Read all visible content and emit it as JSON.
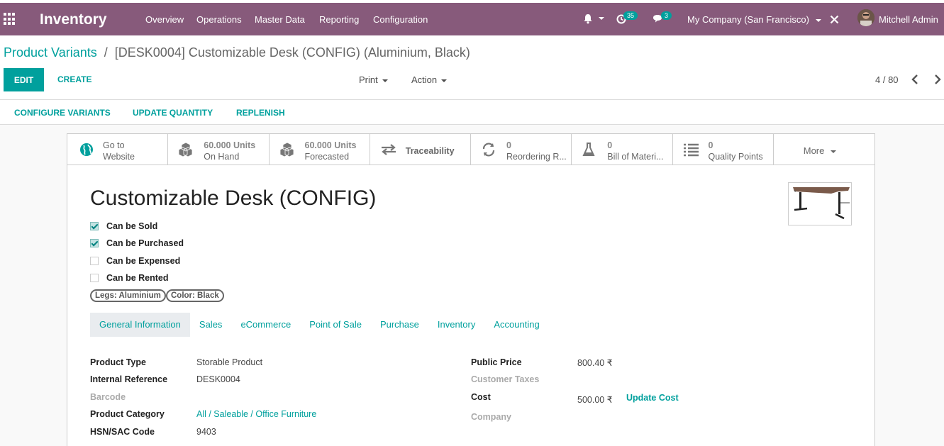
{
  "navbar": {
    "app_title": "Inventory",
    "menus": [
      "Overview",
      "Operations",
      "Master Data",
      "Reporting",
      "Configuration"
    ],
    "activity_count": "35",
    "message_count": "3",
    "company": "My Company (San Francisco)",
    "user": "Mitchell Admin",
    "colors": {
      "bar": "#875a7b",
      "badge": "#00a09d"
    }
  },
  "breadcrumb": {
    "parent": "Product Variants",
    "separator": "/",
    "current": "[DESK0004] Customizable Desk (CONFIG) (Aluminium, Black)"
  },
  "control_panel": {
    "edit": "EDIT",
    "create": "CREATE",
    "print": "Print",
    "action": "Action",
    "pager": "4 / 80"
  },
  "action_bar": [
    "CONFIGURE VARIANTS",
    "UPDATE QUANTITY",
    "REPLENISH"
  ],
  "smart_buttons": [
    {
      "icon": "globe-icon",
      "line1": "Go to",
      "line2": "Website"
    },
    {
      "icon": "cubes-icon",
      "line1": "60.000 Units",
      "line2": "On Hand"
    },
    {
      "icon": "cubes-icon",
      "line1": "60.000 Units",
      "line2": "Forecasted"
    },
    {
      "icon": "exchange-arrows-icon",
      "line1": "Traceability",
      "line2": ""
    },
    {
      "icon": "refresh-icon",
      "line1": "0",
      "line2": "Reordering R..."
    },
    {
      "icon": "flask-icon",
      "line1": "0",
      "line2": "Bill of Materi..."
    },
    {
      "icon": "list-icon",
      "line1": "0",
      "line2": "Quality Points"
    },
    {
      "icon": "",
      "line1": "More",
      "line2": ""
    }
  ],
  "product": {
    "name": "Customizable Desk (CONFIG)",
    "checkboxes": [
      {
        "label": "Can be Sold",
        "checked": true
      },
      {
        "label": "Can be Purchased",
        "checked": true
      },
      {
        "label": "Can be Expensed",
        "checked": false
      },
      {
        "label": "Can be Rented",
        "checked": false
      }
    ],
    "tags": [
      "Legs: Aluminium",
      "Color: Black"
    ]
  },
  "tabs": [
    "General Information",
    "Sales",
    "eCommerce",
    "Point of Sale",
    "Purchase",
    "Inventory",
    "Accounting"
  ],
  "left_fields": [
    {
      "label": "Product Type",
      "value": "Storable Product"
    },
    {
      "label": "Internal Reference",
      "value": "DESK0004"
    },
    {
      "label": "Barcode",
      "value": ""
    },
    {
      "label": "Product Category",
      "value": "All / Saleable / Office Furniture"
    },
    {
      "label": "HSN/SAC Code",
      "value": "9403"
    }
  ],
  "right_fields": [
    {
      "label": "Public Price",
      "value": "800.40 ₹"
    },
    {
      "label": "Customer Taxes",
      "value": ""
    },
    {
      "label": "Cost",
      "value": "500.00 ₹",
      "action": "Update Cost"
    },
    {
      "label": "Company",
      "value": ""
    }
  ]
}
